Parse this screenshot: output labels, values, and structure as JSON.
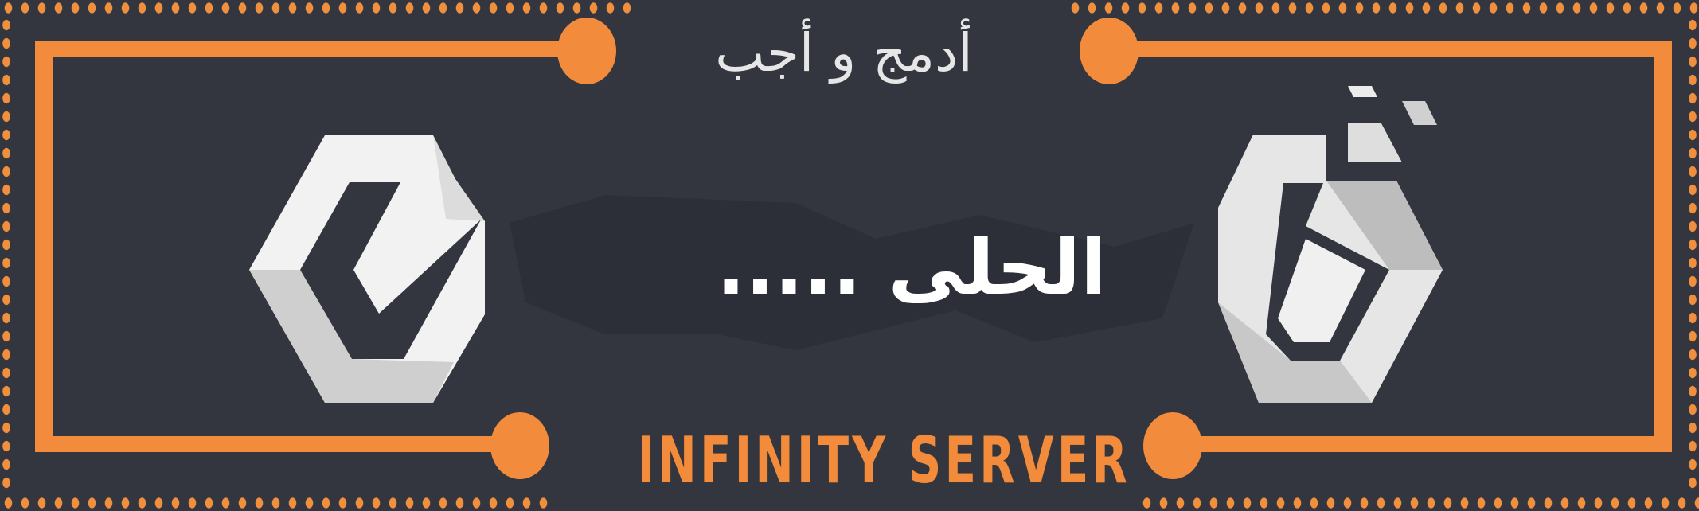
{
  "banner": {
    "top_text": "أدمج و أجب",
    "center_text": "الحلى .....",
    "brand_text": "INFINITY SERVER"
  },
  "colors": {
    "background": "#33363f",
    "accent_orange": "#f28b3c",
    "text_white": "#ffffff"
  },
  "icons": {
    "left_logo": "hexagon-e-logo-icon",
    "right_logo": "hexagon-letter-logo-icon"
  }
}
